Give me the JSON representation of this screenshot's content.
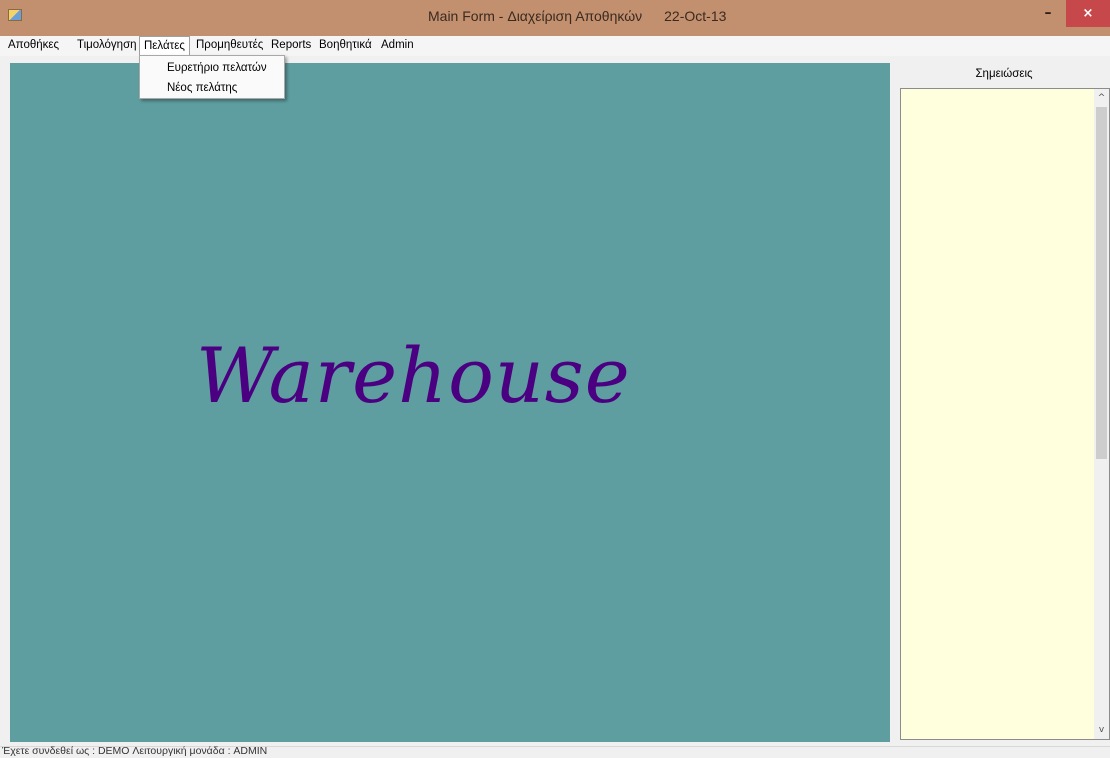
{
  "window": {
    "title": "Main Form - Διαχείριση Αποθηκών",
    "date": "22-Oct-13",
    "minimize_glyph": "–",
    "close_glyph": "×",
    "icon": "app-icon"
  },
  "menu": {
    "items": [
      "Αποθήκες",
      "Τιμολόγηση",
      "Πελάτες",
      "Προμηθευτές",
      "Reports",
      "Βοηθητικά",
      "Admin"
    ],
    "open_item": "Πελάτες",
    "dropdown": [
      "Ευρετήριο πελατών",
      "Νέος πελάτης"
    ]
  },
  "main": {
    "brand": "Warehouse",
    "background": "#5f9ea0",
    "brand_color": "#4b0082"
  },
  "notes": {
    "label": "Σημειώσεις",
    "content": "",
    "scroll_up": "^",
    "scroll_down": "v",
    "background": "#ffffde"
  },
  "status": {
    "text": "Έχετε συνδεθεί ως : DEMO  Λειτουργική μονάδα : ADMIN"
  }
}
